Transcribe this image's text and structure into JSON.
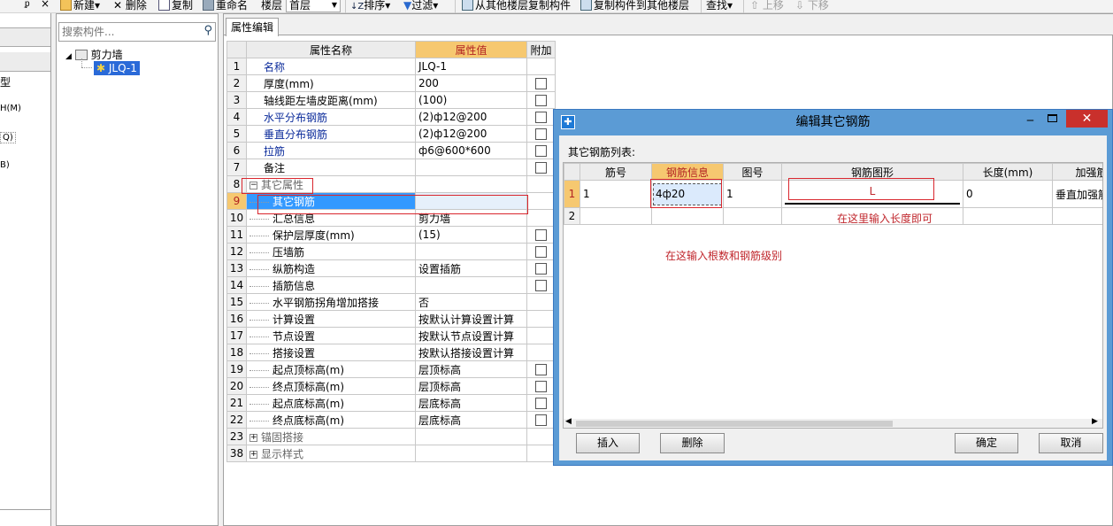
{
  "left_pane": {
    "lines": [
      "型",
      "H(M)",
      "Q)",
      "B)"
    ]
  },
  "toolbar": {
    "new": "新建",
    "delete": "删除",
    "copy": "复制",
    "rename": "重命名",
    "floor_label": "楼层",
    "floor_value": "首层",
    "sort": "排序",
    "filter": "过滤",
    "copy_from_floor": "从其他楼层复制构件",
    "copy_to_floor": "复制构件到其他楼层",
    "find": "查找",
    "move_up": "上移",
    "move_down": "下移"
  },
  "tree": {
    "search_placeholder": "搜索构件...",
    "root_label": "剪力墙",
    "child_label": "JLQ-1"
  },
  "props": {
    "tab": "属性编辑",
    "col_name": "属性名称",
    "col_value": "属性值",
    "col_extra": "附加",
    "rows": [
      {
        "no": "1",
        "name": "名称",
        "value": "JLQ-1"
      },
      {
        "no": "2",
        "name": "厚度(mm)",
        "value": "200"
      },
      {
        "no": "3",
        "name": "轴线距左墙皮距离(mm)",
        "value": "(100)"
      },
      {
        "no": "4",
        "name": "水平分布钢筋",
        "value": "(2)ф12@200"
      },
      {
        "no": "5",
        "name": "垂直分布钢筋",
        "value": "(2)ф12@200"
      },
      {
        "no": "6",
        "name": "拉筋",
        "value": "ф6@600*600"
      },
      {
        "no": "7",
        "name": "备注",
        "value": ""
      },
      {
        "no": "8",
        "name": "其它属性",
        "value": ""
      },
      {
        "no": "9",
        "name": "其它钢筋",
        "value": ""
      },
      {
        "no": "10",
        "name": "汇总信息",
        "value": "剪力墙"
      },
      {
        "no": "11",
        "name": "保护层厚度(mm)",
        "value": "(15)"
      },
      {
        "no": "12",
        "name": "压墙筋",
        "value": ""
      },
      {
        "no": "13",
        "name": "纵筋构造",
        "value": "设置插筋"
      },
      {
        "no": "14",
        "name": "插筋信息",
        "value": ""
      },
      {
        "no": "15",
        "name": "水平钢筋拐角增加搭接",
        "value": "否"
      },
      {
        "no": "16",
        "name": "计算设置",
        "value": "按默认计算设置计算"
      },
      {
        "no": "17",
        "name": "节点设置",
        "value": "按默认节点设置计算"
      },
      {
        "no": "18",
        "name": "搭接设置",
        "value": "按默认搭接设置计算"
      },
      {
        "no": "19",
        "name": "起点顶标高(m)",
        "value": "层顶标高"
      },
      {
        "no": "20",
        "name": "终点顶标高(m)",
        "value": "层顶标高"
      },
      {
        "no": "21",
        "name": "起点底标高(m)",
        "value": "层底标高"
      },
      {
        "no": "22",
        "name": "终点底标高(m)",
        "value": "层底标高"
      },
      {
        "no": "23",
        "name": "锚固搭接",
        "value": ""
      },
      {
        "no": "38",
        "name": "显示样式",
        "value": ""
      }
    ]
  },
  "dialog": {
    "title": "编辑其它钢筋",
    "list_label": "其它钢筋列表:",
    "columns": [
      "筋号",
      "钢筋信息",
      "图号",
      "钢筋图形",
      "长度(mm)",
      "加强筋"
    ],
    "rows": [
      {
        "no": "1",
        "bar_no": "1",
        "info": "4ф20",
        "fig_no": "1",
        "shape": "L",
        "length": "0",
        "type": "垂直加强筋"
      },
      {
        "no": "2",
        "bar_no": "",
        "info": "",
        "fig_no": "",
        "shape": "",
        "length": "",
        "type": ""
      }
    ],
    "note_length": "在这里输入长度即可",
    "note_count": "在这输入根数和钢筋级别",
    "buttons": {
      "insert": "插入",
      "delete": "删除",
      "ok": "确定",
      "cancel": "取消"
    }
  }
}
